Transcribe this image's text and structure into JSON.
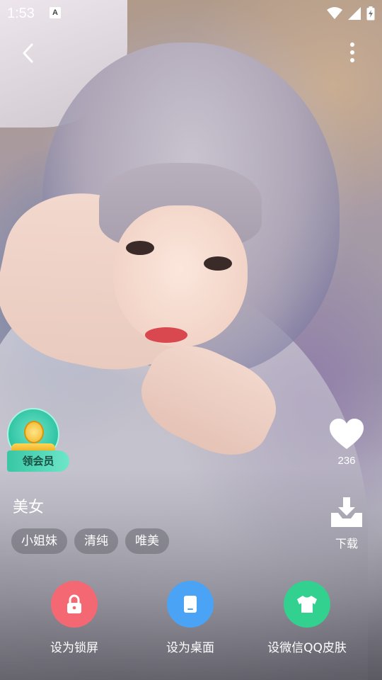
{
  "status_bar": {
    "time": "1:53",
    "a_badge": "A"
  },
  "header": {
    "back_icon": "chevron-left-icon",
    "more_icon": "more-vertical-icon"
  },
  "vip_badge": {
    "label": "领会员"
  },
  "like": {
    "count": "236"
  },
  "download": {
    "label": "下载"
  },
  "wallpaper": {
    "title": "美女",
    "tags": [
      "小姐妹",
      "清纯",
      "唯美"
    ]
  },
  "actions": [
    {
      "label": "设为锁屏",
      "icon": "lock-icon",
      "color": "#f46874"
    },
    {
      "label": "设为桌面",
      "icon": "tablet-icon",
      "color": "#4aa3f5"
    },
    {
      "label": "设微信QQ皮肤",
      "icon": "tshirt-icon",
      "color": "#32d18f"
    }
  ]
}
